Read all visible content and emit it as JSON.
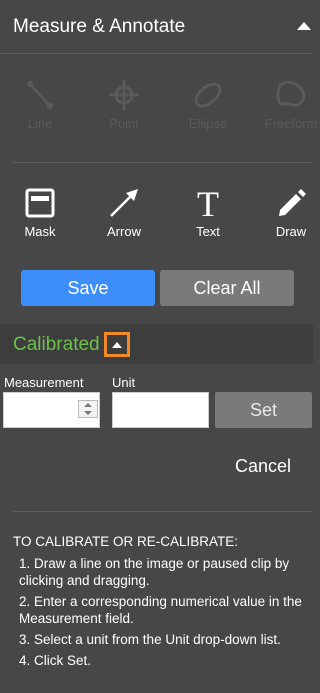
{
  "header": {
    "title": "Measure & Annotate",
    "collapse_icon": "caret-up-icon"
  },
  "measure_tools": [
    {
      "label": "Line",
      "icon": "line-icon",
      "enabled": false
    },
    {
      "label": "Point",
      "icon": "point-icon",
      "enabled": false
    },
    {
      "label": "Ellipse",
      "icon": "ellipse-icon",
      "enabled": false
    },
    {
      "label": "Freeform",
      "icon": "freeform-icon",
      "enabled": false
    }
  ],
  "annotate_tools": [
    {
      "label": "Mask",
      "icon": "mask-icon",
      "enabled": true
    },
    {
      "label": "Arrow",
      "icon": "arrow-icon",
      "enabled": true
    },
    {
      "label": "Text",
      "icon": "text-icon",
      "enabled": true
    },
    {
      "label": "Draw",
      "icon": "pencil-icon",
      "enabled": true
    }
  ],
  "actions": {
    "save": "Save",
    "clear_all": "Clear All"
  },
  "calibration": {
    "title": "Calibrated",
    "toggle_icon": "caret-up-icon",
    "measurement_label": "Measurement",
    "unit_label": "Unit",
    "measurement_value": "",
    "unit_value": "",
    "set": "Set",
    "cancel": "Cancel"
  },
  "instructions": {
    "heading": "TO CALIBRATE OR RE-CALIBRATE:",
    "steps": [
      "1. Draw a line on the image or paused clip by clicking and dragging.",
      "2. Enter a corresponding numerical value in the Measurement field.",
      "3. Select a unit from the Unit drop-down list.",
      "4. Click Set."
    ]
  },
  "colors": {
    "panel_bg": "#474747",
    "accent_blue": "#3d8ef8",
    "calibrated_green": "#6cc04a",
    "highlight_orange": "#f08a24",
    "disabled_gray": "#5a5a5a"
  }
}
